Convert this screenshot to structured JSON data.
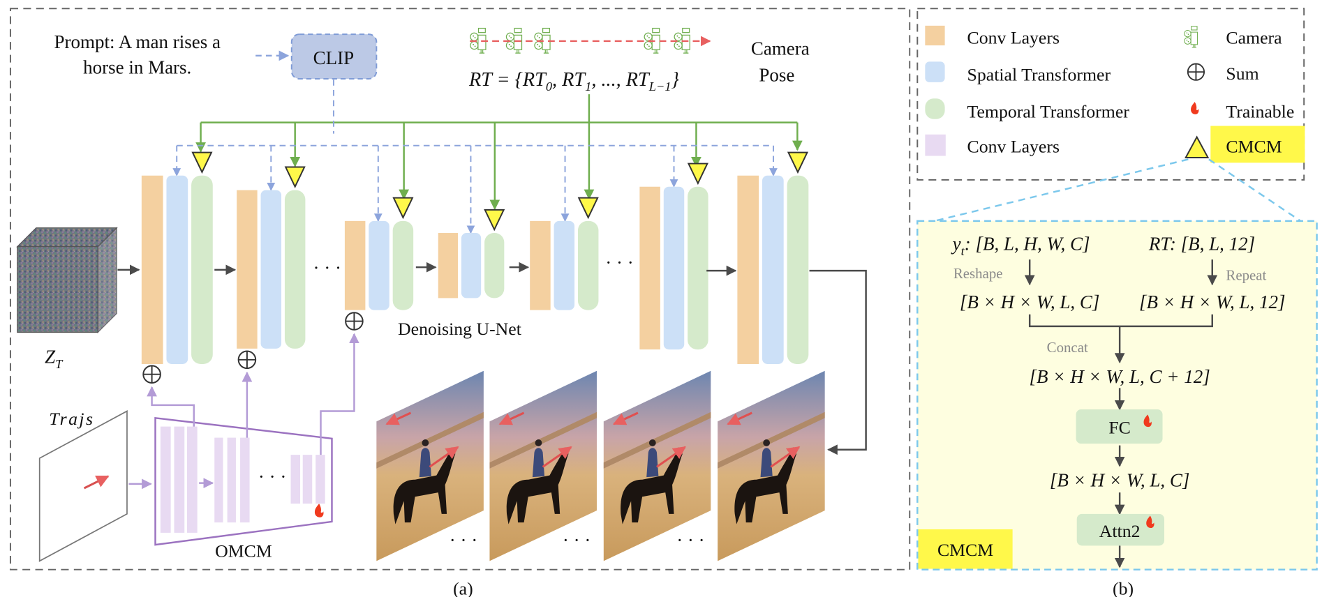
{
  "panel_a": {
    "caption": "(a)",
    "prompt_line1": "Prompt: A man rises a",
    "prompt_line2": "horse in Mars.",
    "clip_label": "CLIP",
    "camera_pose_line1": "Camera",
    "camera_pose_line2": "Pose",
    "rt_formula": "RT = {RT₀, RT₁, ..., RTₗ₋₁}",
    "rt_main": "RT = {RT",
    "rt_sub0": "0",
    "rt_sub1": "1",
    "rt_subL": "L−1",
    "latent_label": "Z",
    "latent_sub": "T",
    "unet_label": "Denoising  U-Net",
    "ellipsis": "· · ·",
    "trajs_label": "Trajs",
    "omcm_label": "OMCM",
    "frame_count": 4
  },
  "legend": {
    "items_left": [
      {
        "label": "Conv Layers",
        "color": "#F4D0A0",
        "shape": "square"
      },
      {
        "label": "Spatial Transformer",
        "color": "#CCE0F7",
        "shape": "rounded"
      },
      {
        "label": "Temporal Transformer",
        "color": "#D5EACB",
        "shape": "rounded"
      },
      {
        "label": "Conv Layers",
        "color": "#E8DAF2",
        "shape": "square"
      }
    ],
    "items_right": [
      {
        "label": "Camera",
        "icon": "camera-icon"
      },
      {
        "label": "Sum",
        "icon": "sum-icon"
      },
      {
        "label": "Trainable",
        "icon": "fire-icon"
      },
      {
        "label": "CMCM",
        "icon": "triangle-icon"
      }
    ]
  },
  "panel_b": {
    "caption": "(b)",
    "yt_label": "y",
    "yt_sub": "t",
    "yt_shape": ": [B, L, H, W, C]",
    "rt_shape": "RT: [B, L, 12]",
    "reshape_label": "Reshape",
    "repeat_label": "Repeat",
    "reshaped": "[B × H × W, L, C]",
    "repeated": "[B × H × W, L, 12]",
    "concat_label": "Concat",
    "concatenated": "[B × H × W, L, C + 12]",
    "fc_label": "FC",
    "fc_out": "[B × H × W, L, C]",
    "attn_label": "Attn2",
    "module_tag": "CMCM"
  },
  "colors": {
    "conv": "#F4D0A0",
    "spatial": "#CCE0F7",
    "temporal": "#D5EACB",
    "omcm_conv": "#E8DAF2",
    "omcm_stroke": "#9B72C0",
    "camera_green": "#6FAE4E",
    "clip_fill": "#BCC9E6",
    "clip_dash": "#7F9BD6",
    "highlight_yellow": "#FFF84A",
    "cmcm_bg": "#FEFEE0",
    "cmcm_dash": "#7CC8EC",
    "fire_red": "#F03A1E",
    "trajectory_red": "#E86060"
  }
}
